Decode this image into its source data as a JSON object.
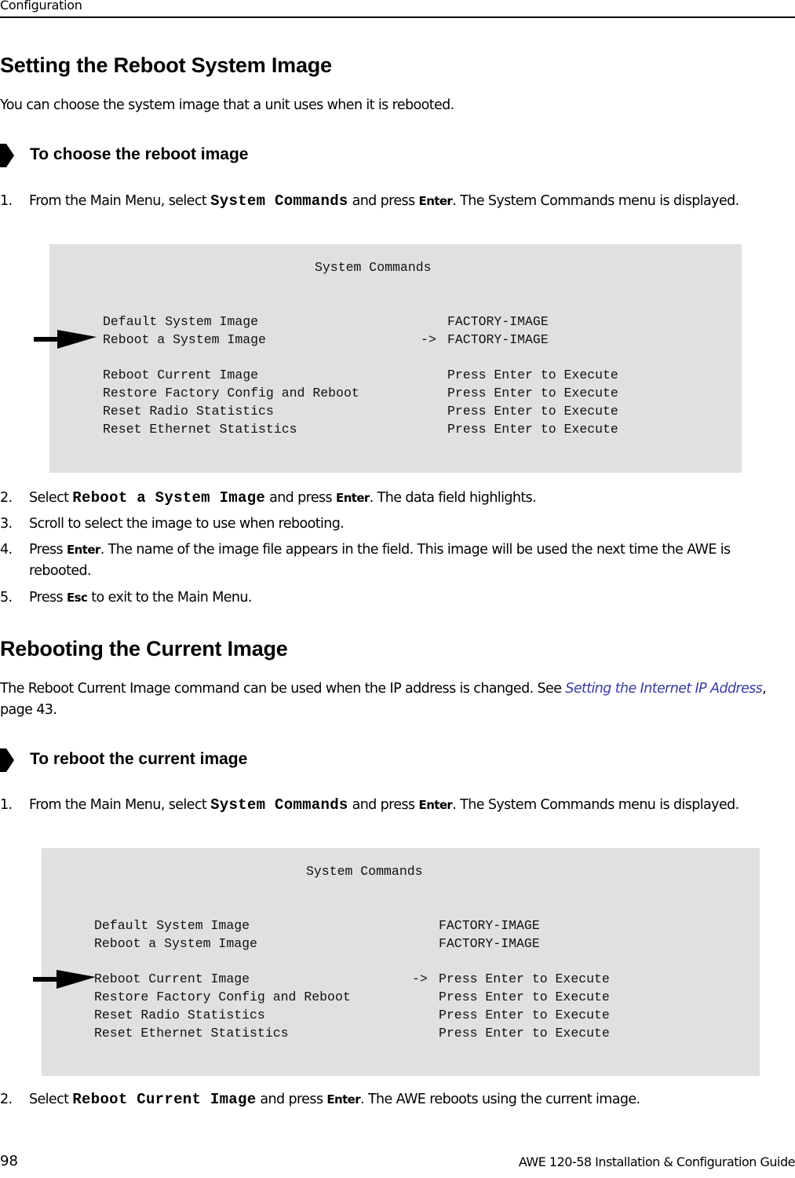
{
  "header": {
    "running_head": "Configuration"
  },
  "section1": {
    "title": "Setting the Reboot System Image",
    "intro": "You can choose the system image that a unit uses when it is rebooted.",
    "procedure_title": "To choose the reboot image",
    "steps": [
      {
        "num": "1.",
        "parts": [
          "From the Main Menu, select ",
          "System Commands",
          " and press ",
          "Enter",
          ". The System Commands menu is displayed."
        ]
      },
      {
        "num": "2.",
        "parts": [
          "Select ",
          "Reboot a System Image",
          " and press ",
          "Enter",
          ". The data field highlights."
        ]
      },
      {
        "num": "3.",
        "text": "Scroll to select the image to use when rebooting."
      },
      {
        "num": "4.",
        "parts": [
          "Press ",
          "Enter",
          ". The name of the image file appears in the field. This image will be used the next time the AWE is rebooted."
        ]
      },
      {
        "num": "5.",
        "parts": [
          "Press ",
          "Esc",
          " to exit to the Main Menu."
        ]
      }
    ],
    "screen": {
      "title": "System Commands",
      "rows": [
        {
          "label": "Default System Image",
          "marker": "",
          "value": "FACTORY-IMAGE"
        },
        {
          "label": "Reboot a System Image",
          "marker": "->",
          "value": "FACTORY-IMAGE"
        },
        {
          "label": "Reboot Current Image",
          "marker": "",
          "value": "Press Enter to Execute"
        },
        {
          "label": "Restore Factory Config and Reboot",
          "marker": "",
          "value": "Press Enter to Execute"
        },
        {
          "label": "Reset Radio Statistics",
          "marker": "",
          "value": "Press Enter to Execute"
        },
        {
          "label": "Reset Ethernet Statistics",
          "marker": "",
          "value": "Press Enter to Execute"
        }
      ]
    }
  },
  "section2": {
    "title": "Rebooting the Current Image",
    "intro_prefix": "The Reboot Current Image command can be used when the IP address is changed. See ",
    "intro_link": "Setting the Internet IP Address",
    "intro_suffix": ", page 43.",
    "procedure_title": "To reboot the current image",
    "steps": [
      {
        "num": "1.",
        "parts": [
          "From the Main Menu, select ",
          "System Commands",
          " and press ",
          "Enter",
          ". The System Commands menu is displayed."
        ]
      },
      {
        "num": "2.",
        "parts": [
          "Select ",
          "Reboot Current Image",
          " and press ",
          "Enter",
          ". The AWE reboots using the current image."
        ]
      }
    ],
    "screen": {
      "title": "System Commands",
      "rows": [
        {
          "label": "Default System Image",
          "marker": "",
          "value": "FACTORY-IMAGE"
        },
        {
          "label": "Reboot a System Image",
          "marker": "",
          "value": "FACTORY-IMAGE"
        },
        {
          "label": "Reboot Current Image",
          "marker": "->",
          "value": "Press Enter to Execute"
        },
        {
          "label": "Restore Factory Config and Reboot",
          "marker": "",
          "value": "Press Enter to Execute"
        },
        {
          "label": "Reset Radio Statistics",
          "marker": "",
          "value": "Press Enter to Execute"
        },
        {
          "label": "Reset Ethernet Statistics",
          "marker": "",
          "value": "Press Enter to Execute"
        }
      ]
    }
  },
  "footer": {
    "page_number": "98",
    "guide_title": "AWE 120-58 Installation & Configuration Guide"
  }
}
